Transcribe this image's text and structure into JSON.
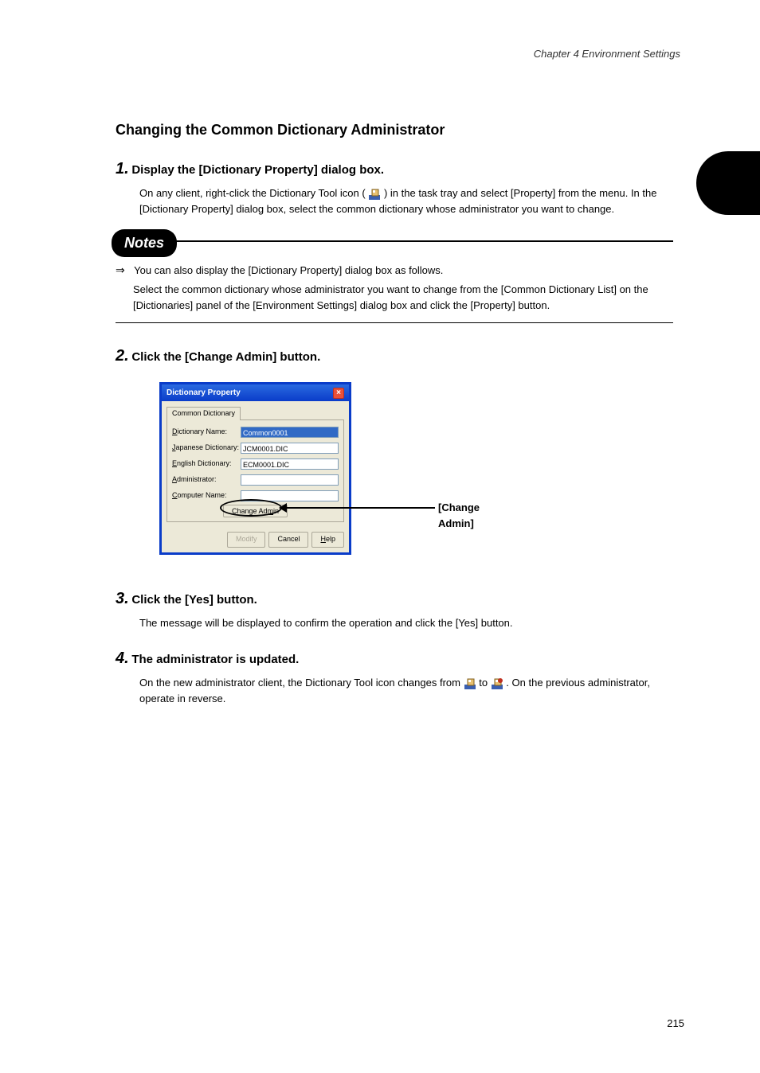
{
  "header_text": "Chapter 4  Environment Settings",
  "page_number": "215",
  "main_title": "Changing the Common Dictionary Administrator",
  "step1": {
    "num": "1.",
    "text": "Display the [Dictionary Property] dialog box.",
    "sub_prefix": "On any client, right-click the Dictionary Tool icon (",
    "sub_suffix": ") in the task tray and select [Property] from the menu. In the [Dictionary Property] dialog box, select the common dictionary whose administrator you want to change."
  },
  "notes_label": "Notes",
  "notes": {
    "line1": "You can also display the [Dictionary Property] dialog box as follows.",
    "line2_prefix": "Select the common dictionary whose administrator you want to change from the ",
    "line2_mid": " on the [Dictionaries] panel of the [Environment Settings] dialog box and click the [Property] button.",
    "ref_label": "[Common Dictionary List]"
  },
  "step2": {
    "num": "2.",
    "text": "Click the [Change Admin] button."
  },
  "dialog": {
    "title": "Dictionary Property",
    "tab": "Common Dictionary",
    "rows": {
      "dict_name_label": "Dictionary Name:",
      "dict_name_value": "Common0001",
      "jp_dict_label": "Japanese Dictionary:",
      "jp_dict_value": "JCM0001.DIC",
      "en_dict_label": "English Dictionary:",
      "en_dict_value": "ECM0001.DIC",
      "admin_label": "Administrator:",
      "admin_value": "",
      "comp_label": "Computer Name:",
      "comp_value": ""
    },
    "change_admin_btn": "Change Admin",
    "modify_btn": "Modify",
    "cancel_btn": "Cancel",
    "help_btn": "Help"
  },
  "arrow_caption": "[Change Admin]",
  "step3": {
    "num": "3.",
    "text": "Click the [Yes] button.",
    "sub": "The message will be displayed to confirm the operation and click the [Yes] button."
  },
  "step4": {
    "num": "4.",
    "text": "The administrator is updated.",
    "sub_prefix": "On the new administrator client, the Dictionary Tool icon changes from ",
    "sub_mid": " to ",
    "sub_suffix": ". On the previous administrator, operate in reverse."
  }
}
